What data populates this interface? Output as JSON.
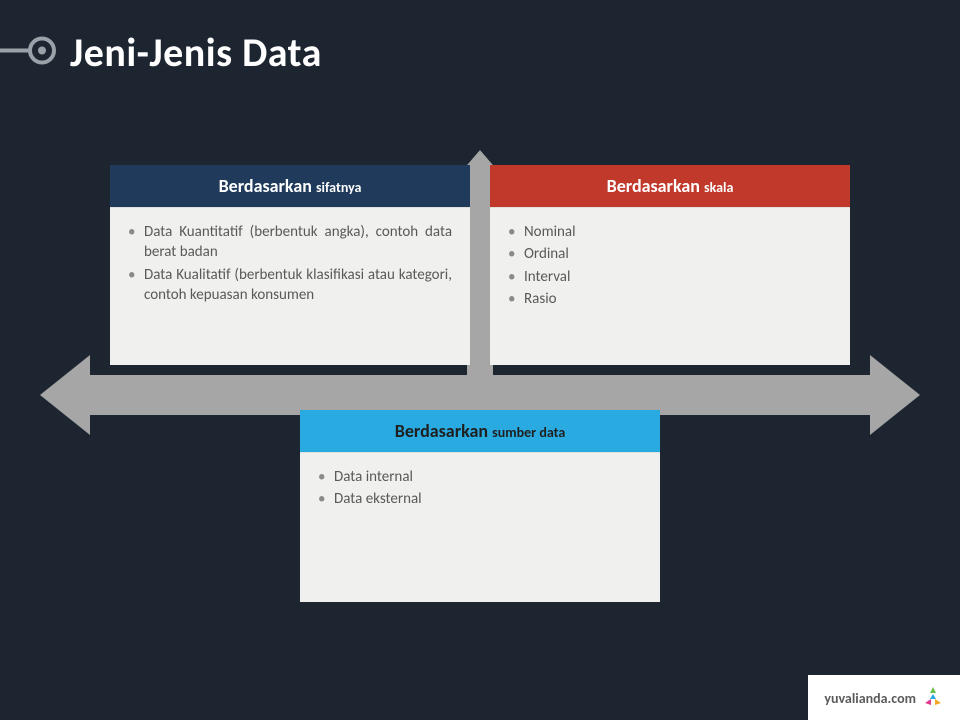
{
  "title": "Jeni-Jenis Data",
  "cards": {
    "sifat": {
      "header_prefix": "Berdasarkan ",
      "header_sub": "sifatnya",
      "items": [
        "Data Kuantitatif (berbentuk angka), contoh data berat badan",
        "Data Kualitatif (berbentuk klasifikasi atau kategori, contoh kepuasan konsumen"
      ]
    },
    "skala": {
      "header_prefix": "Berdasarkan ",
      "header_sub": "skala",
      "items": [
        "Nominal",
        "Ordinal",
        "Interval",
        "Rasio"
      ]
    },
    "sumber": {
      "header_prefix": "Berdasarkan ",
      "header_sub": "sumber data",
      "items": [
        "Data internal",
        "Data eksternal"
      ]
    }
  },
  "brand": {
    "text": "yuvalianda.com"
  },
  "colors": {
    "bg": "#1c2530",
    "header_navy": "#1f3a5a",
    "header_red": "#c0392b",
    "header_blue": "#29abe2",
    "body_bg": "#f0f0ee",
    "arrow": "#a6a6a6"
  }
}
